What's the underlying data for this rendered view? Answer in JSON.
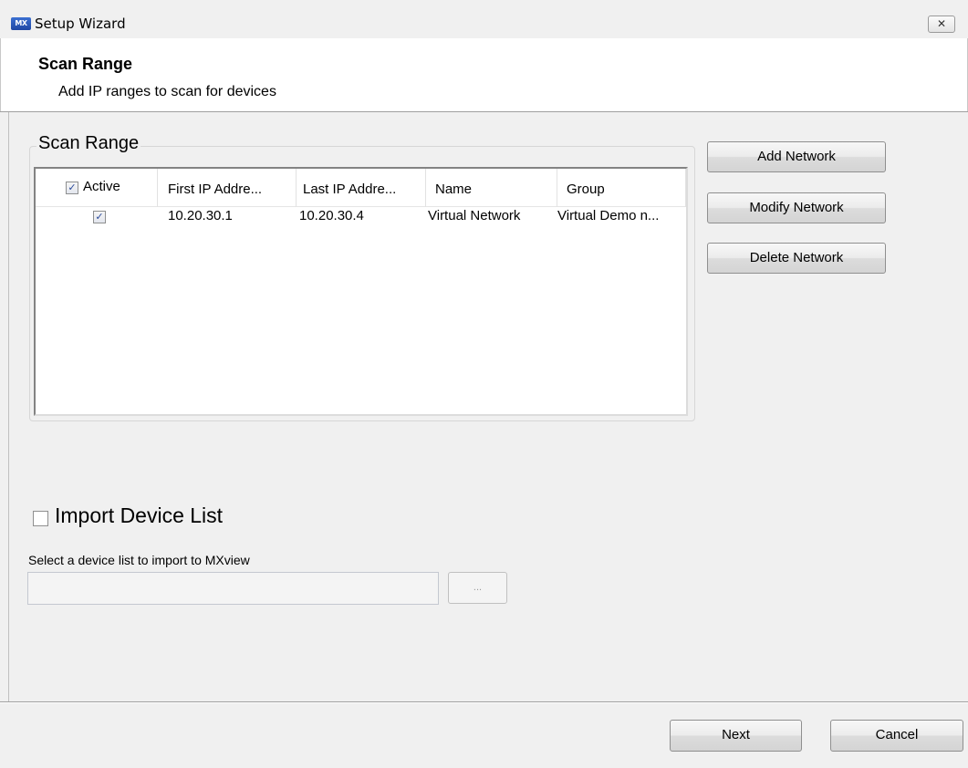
{
  "window": {
    "app_icon_text": "MX",
    "title": "Setup Wizard",
    "close_glyph": "✕"
  },
  "header": {
    "title": "Scan Range",
    "subtitle": "Add IP ranges to scan for devices"
  },
  "scan_range": {
    "group_title": "Scan Range",
    "columns": {
      "active": "Active",
      "first_ip": "First IP Addre...",
      "last_ip": "Last IP Addre...",
      "name": "Name",
      "group": "Group"
    },
    "rows": [
      {
        "active": true,
        "first_ip": "10.20.30.1",
        "last_ip": "10.20.30.4",
        "name": "Virtual Network",
        "group": "Virtual Demo n..."
      }
    ],
    "check_glyph": "✓"
  },
  "actions": {
    "add": "Add Network",
    "modify": "Modify Network",
    "delete": "Delete Network"
  },
  "import": {
    "label": "Import Device List",
    "checked": false,
    "select_label": "Select a device list to import to MXview",
    "path_value": "",
    "browse_label": "..."
  },
  "footer": {
    "next": "Next",
    "cancel": "Cancel"
  }
}
